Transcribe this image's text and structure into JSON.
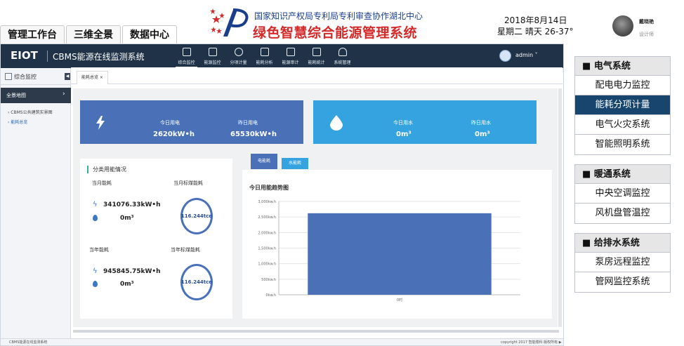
{
  "header": {
    "tabs": [
      {
        "label": "管理工作台",
        "active": false
      },
      {
        "label": "三维全景",
        "active": false
      },
      {
        "label": "数据中心",
        "active": true
      }
    ],
    "org_name": "国家知识产权局专利局专利审查协作湖北中心",
    "system_title": "绿色智慧综合能源管理系统",
    "date": "2018年8月14日",
    "weather": "星期二 晴天 26-37°",
    "user": {
      "name": "戴晓艳",
      "role": "设计师"
    }
  },
  "app": {
    "brand": "EIOT",
    "title": "CBMS能源在线监测系统",
    "nav": [
      {
        "label": "综合监控",
        "icon": "monitor-icon",
        "active": true
      },
      {
        "label": "能源监控",
        "icon": "factory-icon",
        "active": false
      },
      {
        "label": "分项计量",
        "icon": "meter-icon",
        "active": false
      },
      {
        "label": "能耗分析",
        "icon": "analysis-icon",
        "active": false
      },
      {
        "label": "能源审计",
        "icon": "document-icon",
        "active": false
      },
      {
        "label": "能耗统计",
        "icon": "chart-icon",
        "active": false
      },
      {
        "label": "系统管理",
        "icon": "users-icon",
        "active": false
      }
    ],
    "admin": "admin ˅",
    "sidebar": {
      "header": "综合监控",
      "collapse": "◀",
      "section": "全景地图",
      "items": [
        {
          "label": "› CBMS公共建筑实景图",
          "active": false
        },
        {
          "label": "› 能耗总览",
          "active": true
        }
      ]
    },
    "content_tab": "能耗总览 ×",
    "electric": {
      "today_label": "今日用电",
      "today_value": "2620kW•h",
      "yesterday_label": "昨日用电",
      "yesterday_value": "65530kW•h"
    },
    "water": {
      "today_label": "今日用水",
      "today_value": "0m³",
      "yesterday_label": "昨日用水",
      "yesterday_value": "0m³"
    },
    "classification": {
      "title": "分类用能情况",
      "month_label": "当月能耗",
      "month_coal_label": "当月标煤能耗",
      "month_elec": "341076.33kW•h",
      "month_water": "0m³",
      "month_coal": "116.244tce",
      "year_label": "当年能耗",
      "year_coal_label": "当年标煤能耗",
      "year_elec": "945845.75kW•h",
      "year_water": "0m³",
      "year_coal": "116.244tce"
    },
    "chart_tabs": [
      "电能耗",
      "水能耗"
    ],
    "footer_left": "CBMS能源在线监测系统",
    "footer_right": "copyright 2017 智能楼科 版权所有 ▶"
  },
  "chart_data": {
    "type": "bar",
    "title": "今日用能趋势图",
    "categories": [
      "0时"
    ],
    "values": [
      2620
    ],
    "ylim": [
      0,
      3000
    ],
    "yticks": [
      0,
      500,
      1000,
      1500,
      2000,
      2500,
      3000
    ],
    "ytick_labels": [
      "0kw.h",
      "500kw.h",
      "1,000kw.h",
      "1,500kw.h",
      "2,000kw.h",
      "2,500kw.h",
      "3,000kw.h"
    ],
    "grid": true,
    "bar_color": "#4a71b8"
  },
  "right_menu": [
    {
      "title": "电气系统",
      "items": [
        {
          "label": "配电电力监控",
          "active": false
        },
        {
          "label": "能耗分项计量",
          "active": true
        },
        {
          "label": "电气火灾系统",
          "active": false
        },
        {
          "label": "智能照明系统",
          "active": false
        }
      ]
    },
    {
      "title": "暖通系统",
      "items": [
        {
          "label": "中央空调监控",
          "active": false
        },
        {
          "label": "风机盘管温控",
          "active": false
        }
      ]
    },
    {
      "title": "给排水系统",
      "items": [
        {
          "label": "泵房远程监控",
          "active": false
        },
        {
          "label": "管网监控系统",
          "active": false
        }
      ]
    }
  ]
}
